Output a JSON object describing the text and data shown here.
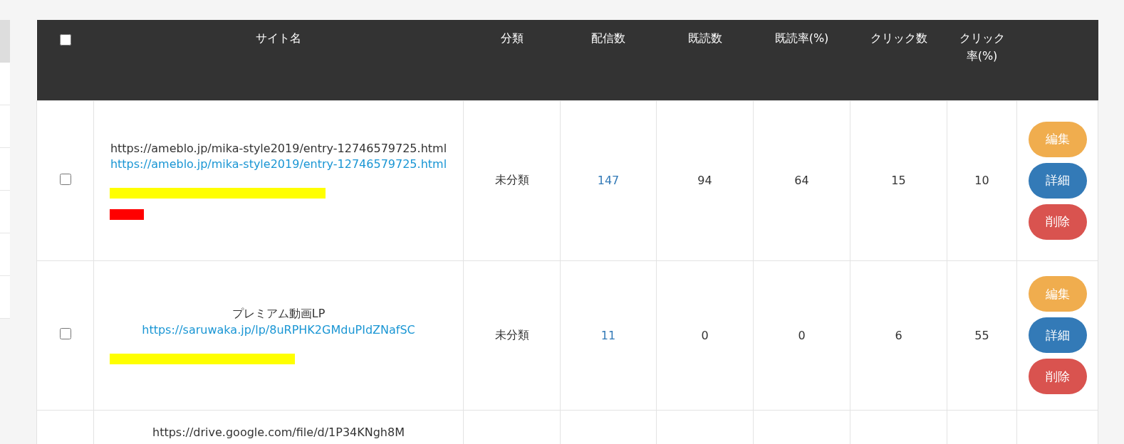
{
  "table": {
    "select_all": {
      "checked": false
    },
    "columns": [
      "サイト名",
      "分類",
      "配信数",
      "既読数",
      "既読率(%)",
      "クリック数",
      "クリック率(%)"
    ],
    "rows": [
      {
        "checked": false,
        "title": "https://ameblo.jp/mika-style2019/entry-12746579725.html",
        "url": "https://ameblo.jp/mika-style2019/entry-12746579725.html",
        "category": "未分類",
        "sent": "147",
        "read": "94",
        "read_rate": "64",
        "clicks": "15",
        "click_rate": "10",
        "marks": [
          {
            "color": "#ffff00",
            "kind": "wide"
          },
          {
            "color": "#ff0000",
            "kind": "short"
          }
        ],
        "actions": [
          {
            "label": "編集",
            "kind": "edit"
          },
          {
            "label": "詳細",
            "kind": "detail"
          },
          {
            "label": "削除",
            "kind": "delete"
          }
        ]
      },
      {
        "checked": false,
        "title": "プレミアム動画LP",
        "url": "https://saruwaka.jp/lp/8uRPHK2GMduPIdZNafSC",
        "category": "未分類",
        "sent": "11",
        "read": "0",
        "read_rate": "0",
        "clicks": "6",
        "click_rate": "55",
        "marks": [
          {
            "color": "#ffff00",
            "kind": "medium"
          }
        ],
        "actions": [
          {
            "label": "編集",
            "kind": "edit"
          },
          {
            "label": "詳細",
            "kind": "detail"
          },
          {
            "label": "削除",
            "kind": "delete"
          }
        ]
      },
      {
        "title": "https://drive.google.com/file/d/1P34KNgh8M"
      }
    ]
  }
}
